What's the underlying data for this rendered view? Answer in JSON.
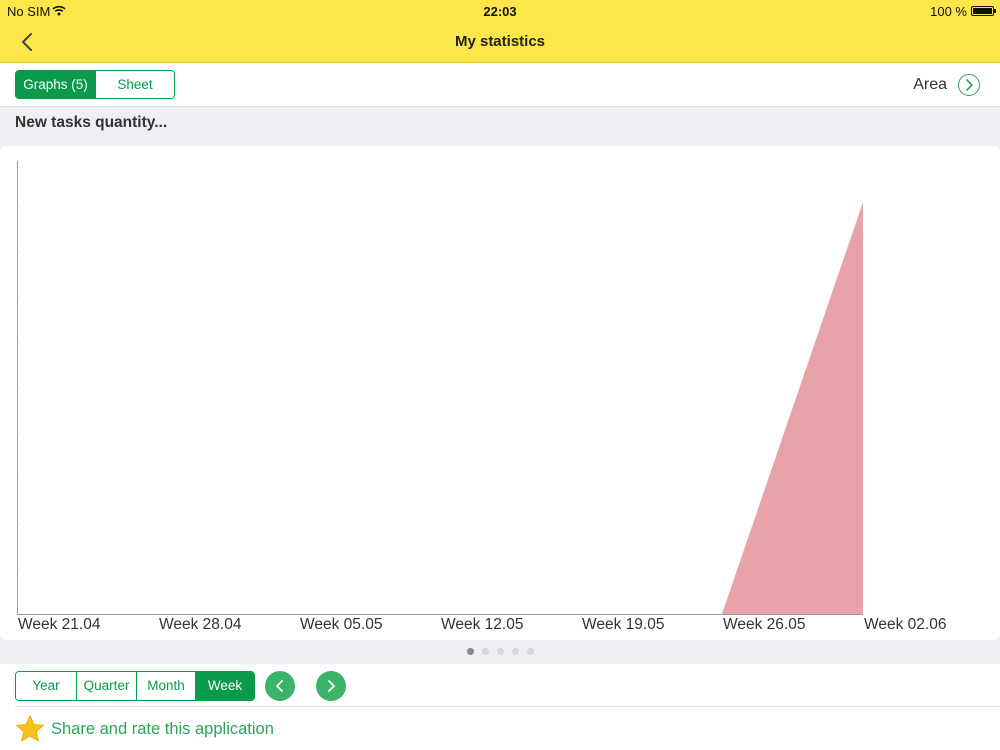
{
  "status": {
    "carrier": "No SIM",
    "time": "22:03",
    "battery": "100 %"
  },
  "nav": {
    "title": "My statistics"
  },
  "view_tabs": {
    "graphs": "Graphs (5)",
    "sheet": "Sheet",
    "selected": "Graphs (5)"
  },
  "chart_type_label": "Area",
  "section_title": "New tasks quantity...",
  "chart_data": {
    "type": "area",
    "categories": [
      "Week 21.04",
      "Week 28.04",
      "Week 05.05",
      "Week 12.05",
      "Week 19.05",
      "Week 26.05",
      "Week 02.06"
    ],
    "series": [
      {
        "values": [
          0,
          0,
          0,
          0,
          0,
          0,
          1
        ],
        "color": "#e8a3a9"
      }
    ],
    "ylim": [
      0,
      1.1
    ],
    "grid": false
  },
  "pager": {
    "count": 5,
    "active": 0
  },
  "period": {
    "options": [
      "Year",
      "Quarter",
      "Month",
      "Week"
    ],
    "selected": "Week"
  },
  "share": {
    "label": "Share and rate this application"
  },
  "colors": {
    "bar": "#fde64a",
    "accent": "#0a9a4b",
    "accent_light": "#3bb369",
    "area": "#e8a3a9"
  }
}
